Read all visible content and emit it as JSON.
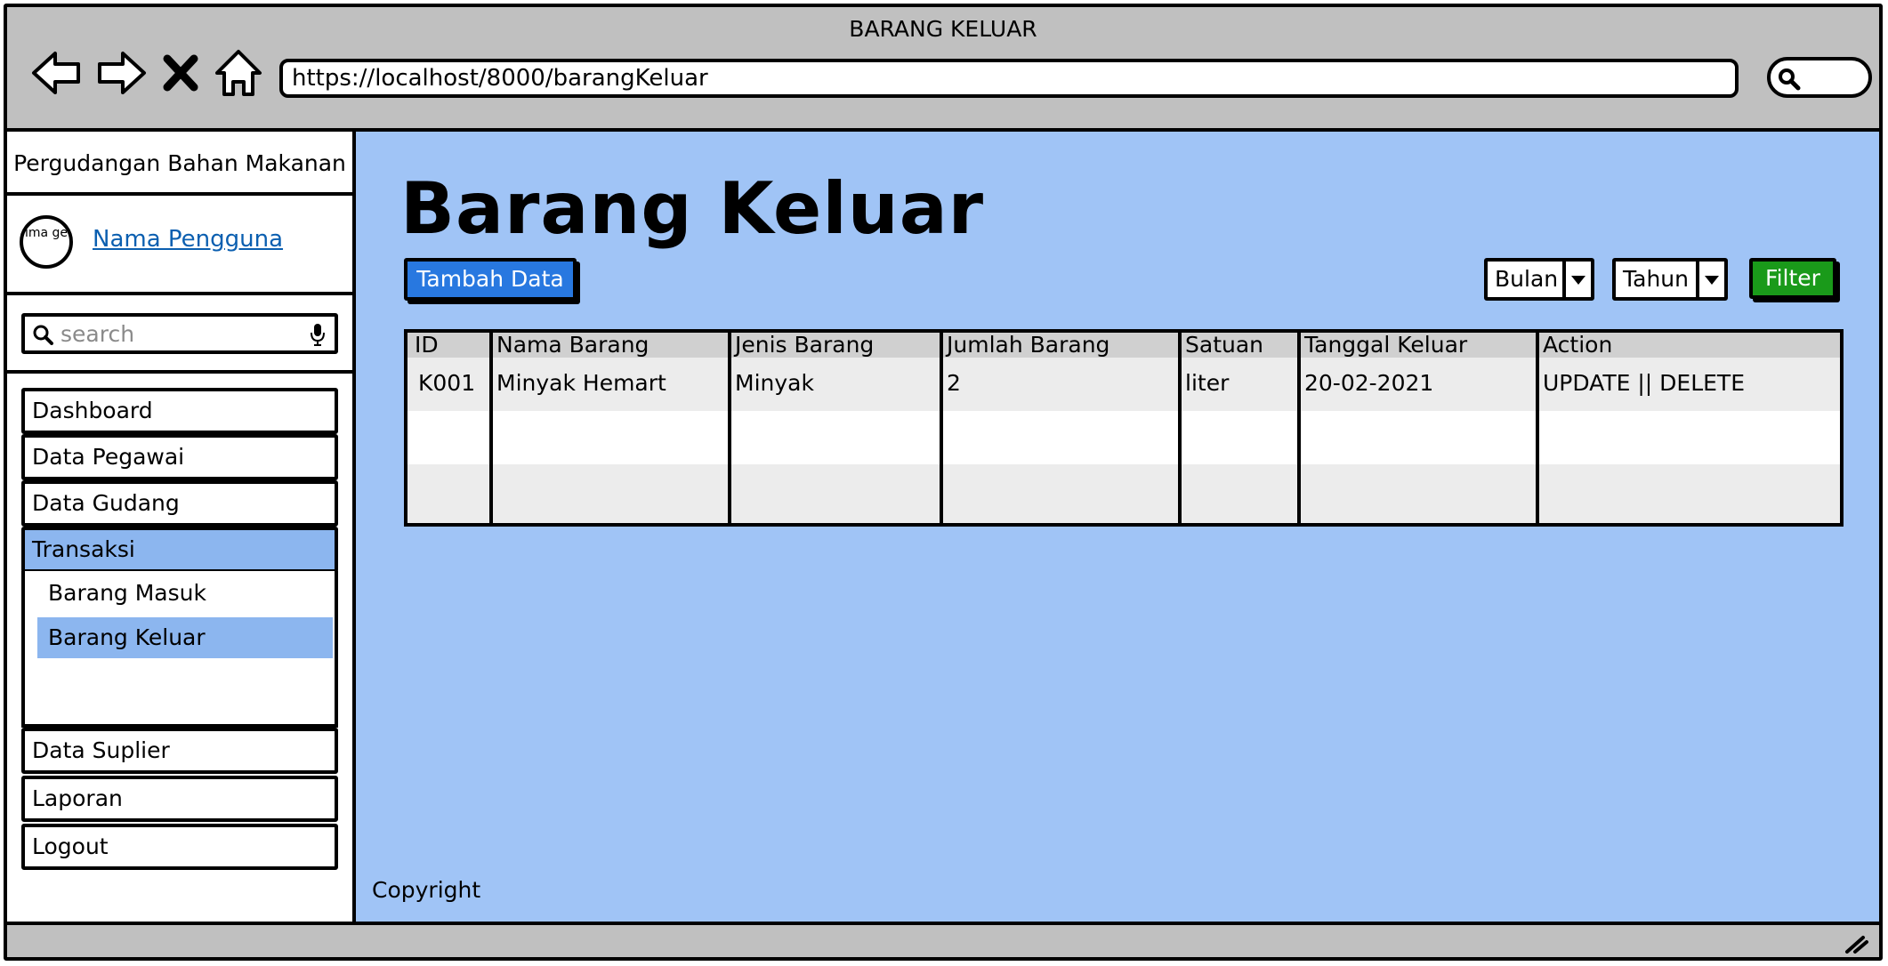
{
  "window": {
    "title": "BARANG KELUAR",
    "url": "https://localhost/8000/barangKeluar"
  },
  "sidebar": {
    "brand": "Pergudangan Bahan Makanan",
    "avatar_text": "ima ge",
    "user_name": "Nama Pengguna",
    "search_placeholder": "search",
    "items": [
      {
        "label": "Dashboard"
      },
      {
        "label": "Data Pegawai"
      },
      {
        "label": "Data Gudang"
      },
      {
        "label": "Transaksi",
        "active": true
      }
    ],
    "sub_items": [
      {
        "label": "Barang Masuk"
      },
      {
        "label": "Barang Keluar",
        "active": true
      }
    ],
    "bottom_items": [
      {
        "label": "Data Suplier"
      },
      {
        "label": "Laporan"
      },
      {
        "label": "Logout"
      }
    ]
  },
  "main": {
    "title": "Barang Keluar",
    "add_button": "Tambah Data",
    "month_select": "Bulan",
    "year_select": "Tahun",
    "filter_button": "Filter",
    "table": {
      "headers": [
        "ID",
        "Nama Barang",
        "Jenis Barang",
        "Jumlah Barang",
        "Satuan",
        "Tanggal Keluar",
        "Action"
      ],
      "rows": [
        [
          "K001",
          "Minyak Hemart",
          "Minyak",
          "2",
          "liter",
          "20-02-2021",
          "UPDATE || DELETE"
        ]
      ]
    },
    "footer": "Copyright"
  },
  "colors": {
    "content_bg": "#a0c4f6",
    "active_item": "#8cb6ef",
    "primary_button": "#2878e0",
    "filter_button": "#1a9a1a",
    "chrome": "#c0c0c0"
  }
}
